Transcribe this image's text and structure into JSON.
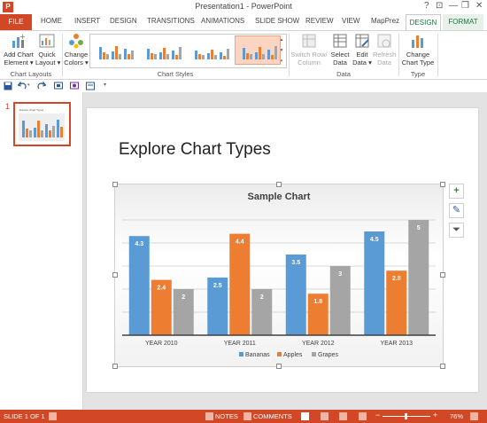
{
  "window": {
    "title": "Presentation1 - PowerPoint",
    "help_glyph": "?",
    "minimize_glyph": "—",
    "restore_glyph": "❐",
    "close_glyph": "✕",
    "restore_ribbon_glyph": "⊡"
  },
  "tabs": {
    "file": "FILE",
    "home": "HOME",
    "insert": "INSERT",
    "design": "DESIGN",
    "transitions": "TRANSITIONS",
    "animations": "ANIMATIONS",
    "slideshow": "SLIDE SHOW",
    "review": "REVIEW",
    "view": "VIEW",
    "mapprez": "MapPrez",
    "chart_design": "DESIGN",
    "chart_format": "FORMAT"
  },
  "ribbon": {
    "add_chart_element": "Add Chart\nElement ▾",
    "quick_layout": "Quick\nLayout ▾",
    "change_colors": "Change\nColors ▾",
    "switch_row_column": "Switch Row/\nColumn",
    "select_data": "Select\nData",
    "edit_data": "Edit\nData ▾",
    "refresh_data": "Refresh\nData",
    "change_chart_type": "Change\nChart Type",
    "group_chart_layouts": "Chart Layouts",
    "group_chart_styles": "Chart Styles",
    "group_data": "Data",
    "group_type": "Type",
    "gallery_up": "▲",
    "gallery_down": "▼",
    "gallery_more": "▾"
  },
  "qat": {
    "customize": "▾"
  },
  "thumbnail": {
    "number": "1",
    "mini_title": "Explore Chart Types"
  },
  "slide": {
    "title": "Explore Chart Types"
  },
  "chart_data": {
    "type": "bar",
    "title": "Sample Chart",
    "categories": [
      "YEAR 2010",
      "YEAR 2011",
      "YEAR 2012",
      "YEAR 2013"
    ],
    "series": [
      {
        "name": "Bananas",
        "values": [
          4.3,
          2.5,
          3.5,
          4.5
        ],
        "color": "#5b9bd5"
      },
      {
        "name": "Apples",
        "values": [
          2.4,
          4.4,
          1.8,
          2.8
        ],
        "color": "#ed7d31"
      },
      {
        "name": "Grapes",
        "values": [
          2,
          2,
          3,
          5
        ],
        "color": "#a5a5a5"
      }
    ],
    "ylim": [
      0,
      5
    ],
    "grid": true,
    "legend": "bottom",
    "data_labels": true
  },
  "chart_tools": {
    "add": "+",
    "style": "✎",
    "filter": "⏷"
  },
  "status": {
    "slide": "SLIDE 1 OF 1",
    "notes": "NOTES",
    "comments": "COMMENTS",
    "zoom": "76%",
    "zoom_out": "−",
    "zoom_in": "+"
  },
  "colors": {
    "accent": "#d24726",
    "chart_tab": "#1e7145"
  }
}
